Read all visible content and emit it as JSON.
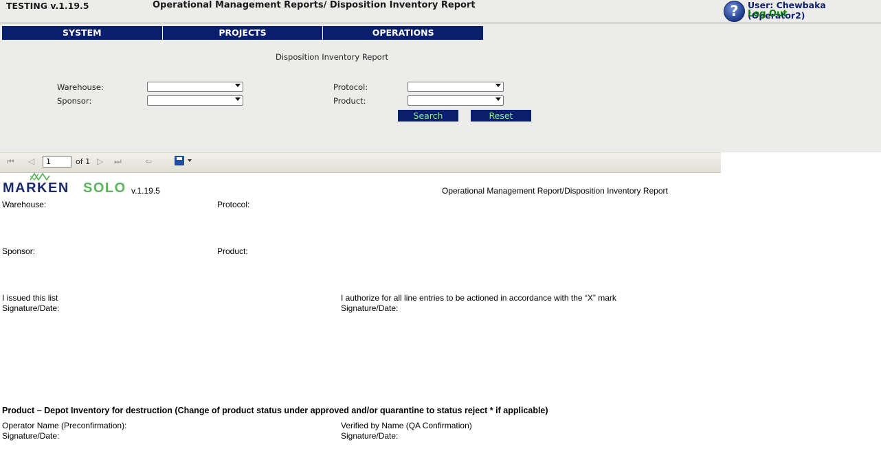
{
  "header": {
    "version": "TESTING v.1.19.5",
    "title": "Operational Management Reports/ Disposition Inventory Report",
    "help_icon": "?",
    "user": "User: Chewbaka (Operator2)",
    "logout": "Log Out"
  },
  "nav": [
    "SYSTEM",
    "PROJECTS",
    "OPERATIONS"
  ],
  "filters": {
    "title": "Disposition Inventory Report",
    "warehouse_label": "Warehouse:",
    "sponsor_label": "Sponsor:",
    "protocol_label": "Protocol:",
    "product_label": "Product:",
    "warehouse_value": "",
    "sponsor_value": "",
    "protocol_value": "",
    "product_value": "",
    "search_button": "Search",
    "reset_button": "Reset"
  },
  "toolbar": {
    "first_icon": "⏮",
    "prev_icon": "◁",
    "page_value": "1",
    "page_of": "of 1",
    "next_icon": "▷",
    "last_icon": "⏭",
    "back_icon": "⇦"
  },
  "report": {
    "logo_marken": "MARKEN",
    "logo_solo": "SOLO",
    "logo_version": "v.1.19.5",
    "title": "Operational Management Report/Disposition Inventory Report",
    "warehouse_label": "Warehouse:",
    "protocol_label": "Protocol:",
    "sponsor_label": "Sponsor:",
    "product_label": "Product:",
    "issued_label": "I issued this list",
    "issued_sig": "Signature/Date:",
    "authorize_label": "I authorize for all line entries to be actioned in accordance with the “X” mark",
    "authorize_sig": "Signature/Date:",
    "section_heading": "Product – Depot Inventory for destruction (Change of product status under approved and/or quarantine to status reject * if applicable)",
    "operator_label": "Operator Name (Preconfirmation):",
    "operator_sig": "Signature/Date:",
    "verified_label": "Verified by Name (QA Confirmation)",
    "verified_sig": "Signature/Date:"
  },
  "colors": {
    "nav_bg": "#0a1e6e",
    "button_text": "#8cf08c",
    "logout": "#0a7a0a",
    "logo_marken": "#1b2a6b",
    "logo_solo": "#5bb55b"
  }
}
